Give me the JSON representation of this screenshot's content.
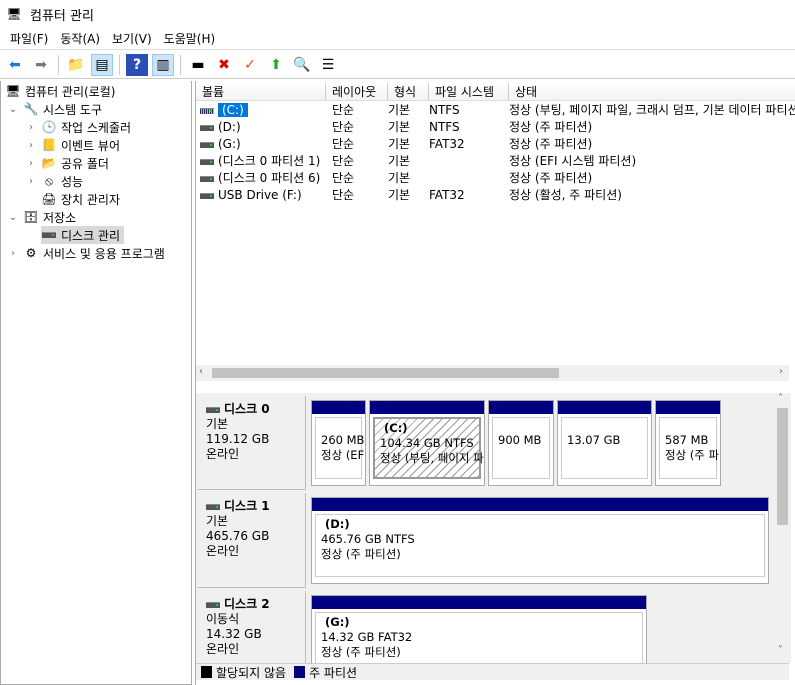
{
  "window": {
    "title": "컴퓨터 관리"
  },
  "menu": [
    "파일(F)",
    "동작(A)",
    "보기(V)",
    "도움말(H)"
  ],
  "tree": [
    {
      "label": "컴퓨터 관리(로컬)",
      "icon": "computer-icon"
    },
    {
      "label": "시스템 도구",
      "icon": "tools-icon"
    },
    {
      "label": "작업 스케줄러",
      "icon": "clock-icon"
    },
    {
      "label": "이벤트 뷰어",
      "icon": "event-viewer-icon"
    },
    {
      "label": "공유 폴더",
      "icon": "shared-folder-icon"
    },
    {
      "label": "성능",
      "icon": "performance-icon"
    },
    {
      "label": "장치 관리자",
      "icon": "device-manager-icon"
    },
    {
      "label": "저장소",
      "icon": "storage-icon"
    },
    {
      "label": "디스크 관리",
      "icon": "disk-icon"
    },
    {
      "label": "서비스 및 응용 프로그램",
      "icon": "services-icon"
    }
  ],
  "volumes": {
    "columns": [
      "볼륨",
      "레이아웃",
      "형식",
      "파일 시스템",
      "상태"
    ],
    "rows": [
      [
        "(C:)",
        "단순",
        "기본",
        "NTFS",
        "정상 (부팅, 페이지 파일, 크래시 덤프, 기본 데이터 파티션)"
      ],
      [
        "(D:)",
        "단순",
        "기본",
        "NTFS",
        "정상 (주 파티션)"
      ],
      [
        "(G:)",
        "단순",
        "기본",
        "FAT32",
        "정상 (주 파티션)"
      ],
      [
        "(디스크 0 파티션 1)",
        "단순",
        "기본",
        "",
        "정상 (EFI 시스템 파티션)"
      ],
      [
        "(디스크 0 파티션 6)",
        "단순",
        "기본",
        "",
        "정상 (주 파티션)"
      ],
      [
        "USB Drive (F:)",
        "단순",
        "기본",
        "FAT32",
        "정상 (활성, 주 파티션)"
      ]
    ]
  },
  "disks": [
    {
      "name": "디스크 0",
      "type": "기본",
      "size": "119.12 GB",
      "status": "온라인",
      "parts": [
        {
          "name": "",
          "size": "260 MB",
          "status": "정상 (EFI 시스템 파티션)"
        },
        {
          "name": "(C:)",
          "size": "104.34 GB NTFS",
          "status": "정상 (부팅, 페이지 파일)"
        },
        {
          "name": "",
          "size": "900 MB",
          "status": ""
        },
        {
          "name": "",
          "size": "13.07 GB",
          "status": ""
        },
        {
          "name": "",
          "size": "587 MB",
          "status": "정상 (주 파티션)"
        }
      ]
    },
    {
      "name": "디스크 1",
      "type": "기본",
      "size": "465.76 GB",
      "status": "온라인",
      "parts": [
        {
          "name": "(D:)",
          "size": "465.76 GB NTFS",
          "status": "정상 (주 파티션)"
        }
      ]
    },
    {
      "name": "디스크 2",
      "type": "이동식",
      "size": "14.32 GB",
      "status": "온라인",
      "parts": [
        {
          "name": "(G:)",
          "size": "14.32 GB FAT32",
          "status": "정상 (주 파티션)"
        }
      ]
    }
  ],
  "legend": [
    {
      "label": "할당되지 않음",
      "color": "#000000"
    },
    {
      "label": "주 파티션",
      "color": "#000080"
    }
  ]
}
